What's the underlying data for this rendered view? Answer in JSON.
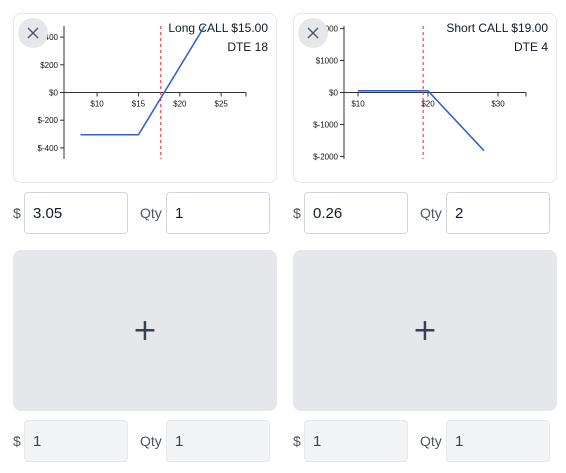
{
  "cards": [
    {
      "title_line1": "Long CALL $15.00",
      "title_line2": "DTE 18",
      "price": "3.05",
      "qty": "1",
      "price_label": "$",
      "qty_label": "Qty"
    },
    {
      "title_line1": "Short CALL $19.00",
      "title_line2": "DTE 4",
      "price": "0.26",
      "qty": "2",
      "price_label": "$",
      "qty_label": "Qty"
    }
  ],
  "empty_slots": [
    {
      "price": "1",
      "qty": "1",
      "price_label": "$",
      "qty_label": "Qty"
    },
    {
      "price": "1",
      "qty": "1",
      "price_label": "$",
      "qty_label": "Qty"
    }
  ],
  "icons": {
    "close": "close-icon",
    "add": "plus-icon"
  },
  "add_symbol": "+",
  "colors": {
    "line": "#3461d6",
    "strike": "#dc2626",
    "add_bg": "#e5e7eb"
  },
  "chart_data": [
    {
      "type": "line",
      "title": "Long CALL $15.00",
      "subtitle": "DTE 18",
      "x_ticks": [
        "$10",
        "$15",
        "$20",
        "$25"
      ],
      "x_tick_values": [
        10,
        15,
        20,
        25
      ],
      "y_ticks": [
        "$-400",
        "$-200",
        "$0",
        "$200",
        "$400"
      ],
      "y_tick_values": [
        -400,
        -200,
        0,
        200,
        400
      ],
      "xlim": [
        6,
        28
      ],
      "ylim": [
        -480,
        480
      ],
      "strike_line": 17.7,
      "x": [
        8,
        15,
        23
      ],
      "y": [
        -305,
        -305,
        480
      ]
    },
    {
      "type": "line",
      "title": "Short CALL $19.00",
      "subtitle": "DTE 4",
      "x_ticks": [
        "$10",
        "$20",
        "$30"
      ],
      "x_tick_values": [
        10,
        20,
        30
      ],
      "y_ticks": [
        "$-2000",
        "$-1000",
        "$0",
        "$1000",
        "$2000"
      ],
      "y_tick_values": [
        -2000,
        -1000,
        0,
        1000,
        2000
      ],
      "xlim": [
        8,
        34
      ],
      "ylim": [
        -2080,
        2080
      ],
      "strike_line": 19.3,
      "x": [
        10,
        20,
        28
      ],
      "y": [
        52,
        52,
        -1820
      ]
    }
  ]
}
